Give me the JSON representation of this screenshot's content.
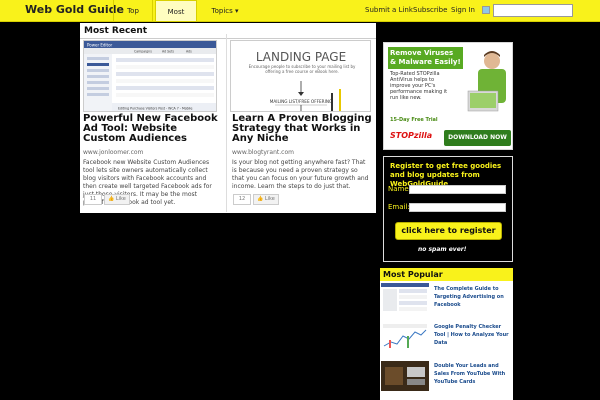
{
  "header": {
    "logo": "Web Gold Guide",
    "nav": [
      "Top Stories",
      "Most Recent",
      "Topics ▾"
    ],
    "links": [
      "Submit a Link",
      "Subscribe",
      "Sign In"
    ],
    "search_placeholder": "",
    "twitter_icon": "twitter-icon"
  },
  "main": {
    "section_title": "Most Recent",
    "cards": [
      {
        "title": "Powerful New Facebook Ad Tool: Website Custom Audiences",
        "source": "www.jonloomer.com",
        "excerpt": "Facebook new Website Custom Audiences tool lets site owners automatically collect blog visitors with Facebook accounts and then create well targeted Facebook ads for just those visitors. It may be the most powerful Facebook ad tool yet.",
        "share_count": "11",
        "like_label": "Like",
        "thumb_header": "Power Editor",
        "thumb_tabs": [
          "Campaigns",
          "Ad Sets",
          "Ads"
        ],
        "thumb_caption": "Editing Purchase Visitors Post - WCA 7 - Mobile"
      },
      {
        "title": "Learn A Proven Blogging Strategy that Works in Any Niche",
        "source": "www.blogtyrant.com",
        "excerpt": "Is your blog not getting anywhere fast? That is because you need a proven strategy so that you can focus on your future growth and income. Learn the steps to do just that.",
        "share_count": "12",
        "like_label": "Like",
        "thumb_heading": "LANDING PAGE",
        "thumb_text": "Encourage people to subscribe to your mailing list by offering a free course or eBook here.",
        "thumb_label": "MAILING LIST/FREE OFFERING"
      }
    ]
  },
  "sidebar": {
    "ad": {
      "headline": "Remove Viruses & Malware Easily!",
      "body": "Top-Rated STOPzilla AntiVirus helps to improve your PC's performance making it run like new.",
      "trial": "15-Day Free Trial",
      "brand": "STOPzilla",
      "cta": "DOWNLOAD NOW"
    },
    "signup": {
      "text": "Register to get free goodies and blog updates from WebGoldGuide",
      "name_label": "Name:",
      "email_label": "Email:",
      "button": "click here to register",
      "nospam": "no spam ever!"
    },
    "popular": {
      "title": "Most Popular",
      "items": [
        {
          "title": "The Complete Guide to Targeting Advertising on Facebook"
        },
        {
          "title": "Google Penalty Checker Tool | How to Analyze Your Data"
        },
        {
          "title": "Double Your Leads and Sales From YouTube With YouTube Cards"
        }
      ]
    }
  },
  "colors": {
    "accent_yellow": "#f9f21b",
    "link_blue": "#1a4b8c",
    "ad_green": "#58aa22",
    "download_green": "#2f7d1d",
    "brand_red": "#dd1111"
  }
}
